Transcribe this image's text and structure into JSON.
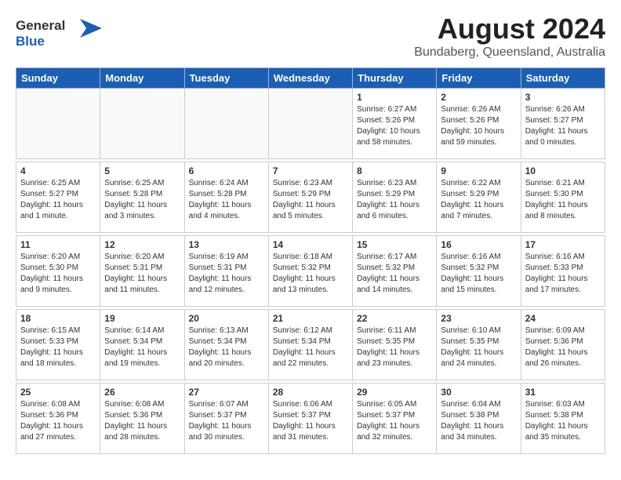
{
  "header": {
    "logo_general": "General",
    "logo_blue": "Blue",
    "main_title": "August 2024",
    "subtitle": "Bundaberg, Queensland, Australia"
  },
  "days_of_week": [
    "Sunday",
    "Monday",
    "Tuesday",
    "Wednesday",
    "Thursday",
    "Friday",
    "Saturday"
  ],
  "weeks": [
    [
      {
        "day": "",
        "info": ""
      },
      {
        "day": "",
        "info": ""
      },
      {
        "day": "",
        "info": ""
      },
      {
        "day": "",
        "info": ""
      },
      {
        "day": "1",
        "info": "Sunrise: 6:27 AM\nSunset: 5:26 PM\nDaylight: 10 hours and 58 minutes."
      },
      {
        "day": "2",
        "info": "Sunrise: 6:26 AM\nSunset: 5:26 PM\nDaylight: 10 hours and 59 minutes."
      },
      {
        "day": "3",
        "info": "Sunrise: 6:26 AM\nSunset: 5:27 PM\nDaylight: 11 hours and 0 minutes."
      }
    ],
    [
      {
        "day": "4",
        "info": "Sunrise: 6:25 AM\nSunset: 5:27 PM\nDaylight: 11 hours and 1 minute."
      },
      {
        "day": "5",
        "info": "Sunrise: 6:25 AM\nSunset: 5:28 PM\nDaylight: 11 hours and 3 minutes."
      },
      {
        "day": "6",
        "info": "Sunrise: 6:24 AM\nSunset: 5:28 PM\nDaylight: 11 hours and 4 minutes."
      },
      {
        "day": "7",
        "info": "Sunrise: 6:23 AM\nSunset: 5:29 PM\nDaylight: 11 hours and 5 minutes."
      },
      {
        "day": "8",
        "info": "Sunrise: 6:23 AM\nSunset: 5:29 PM\nDaylight: 11 hours and 6 minutes."
      },
      {
        "day": "9",
        "info": "Sunrise: 6:22 AM\nSunset: 5:29 PM\nDaylight: 11 hours and 7 minutes."
      },
      {
        "day": "10",
        "info": "Sunrise: 6:21 AM\nSunset: 5:30 PM\nDaylight: 11 hours and 8 minutes."
      }
    ],
    [
      {
        "day": "11",
        "info": "Sunrise: 6:20 AM\nSunset: 5:30 PM\nDaylight: 11 hours and 9 minutes."
      },
      {
        "day": "12",
        "info": "Sunrise: 6:20 AM\nSunset: 5:31 PM\nDaylight: 11 hours and 11 minutes."
      },
      {
        "day": "13",
        "info": "Sunrise: 6:19 AM\nSunset: 5:31 PM\nDaylight: 11 hours and 12 minutes."
      },
      {
        "day": "14",
        "info": "Sunrise: 6:18 AM\nSunset: 5:32 PM\nDaylight: 11 hours and 13 minutes."
      },
      {
        "day": "15",
        "info": "Sunrise: 6:17 AM\nSunset: 5:32 PM\nDaylight: 11 hours and 14 minutes."
      },
      {
        "day": "16",
        "info": "Sunrise: 6:16 AM\nSunset: 5:32 PM\nDaylight: 11 hours and 15 minutes."
      },
      {
        "day": "17",
        "info": "Sunrise: 6:16 AM\nSunset: 5:33 PM\nDaylight: 11 hours and 17 minutes."
      }
    ],
    [
      {
        "day": "18",
        "info": "Sunrise: 6:15 AM\nSunset: 5:33 PM\nDaylight: 11 hours and 18 minutes."
      },
      {
        "day": "19",
        "info": "Sunrise: 6:14 AM\nSunset: 5:34 PM\nDaylight: 11 hours and 19 minutes."
      },
      {
        "day": "20",
        "info": "Sunrise: 6:13 AM\nSunset: 5:34 PM\nDaylight: 11 hours and 20 minutes."
      },
      {
        "day": "21",
        "info": "Sunrise: 6:12 AM\nSunset: 5:34 PM\nDaylight: 11 hours and 22 minutes."
      },
      {
        "day": "22",
        "info": "Sunrise: 6:11 AM\nSunset: 5:35 PM\nDaylight: 11 hours and 23 minutes."
      },
      {
        "day": "23",
        "info": "Sunrise: 6:10 AM\nSunset: 5:35 PM\nDaylight: 11 hours and 24 minutes."
      },
      {
        "day": "24",
        "info": "Sunrise: 6:09 AM\nSunset: 5:36 PM\nDaylight: 11 hours and 26 minutes."
      }
    ],
    [
      {
        "day": "25",
        "info": "Sunrise: 6:08 AM\nSunset: 5:36 PM\nDaylight: 11 hours and 27 minutes."
      },
      {
        "day": "26",
        "info": "Sunrise: 6:08 AM\nSunset: 5:36 PM\nDaylight: 11 hours and 28 minutes."
      },
      {
        "day": "27",
        "info": "Sunrise: 6:07 AM\nSunset: 5:37 PM\nDaylight: 11 hours and 30 minutes."
      },
      {
        "day": "28",
        "info": "Sunrise: 6:06 AM\nSunset: 5:37 PM\nDaylight: 11 hours and 31 minutes."
      },
      {
        "day": "29",
        "info": "Sunrise: 6:05 AM\nSunset: 5:37 PM\nDaylight: 11 hours and 32 minutes."
      },
      {
        "day": "30",
        "info": "Sunrise: 6:04 AM\nSunset: 5:38 PM\nDaylight: 11 hours and 34 minutes."
      },
      {
        "day": "31",
        "info": "Sunrise: 6:03 AM\nSunset: 5:38 PM\nDaylight: 11 hours and 35 minutes."
      }
    ]
  ]
}
